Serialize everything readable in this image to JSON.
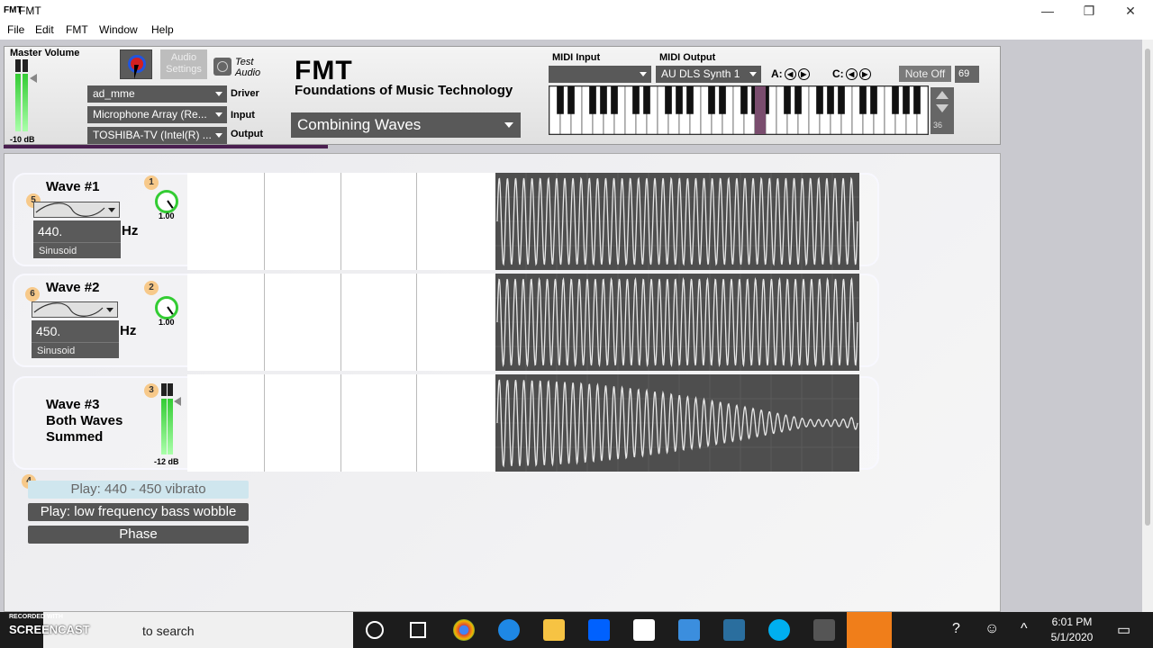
{
  "window": {
    "app_icon": "FMT",
    "title": "FMT",
    "controls": {
      "minimize": "—",
      "restore": "❐",
      "close": "✕"
    }
  },
  "menu": [
    "File",
    "Edit",
    "FMT",
    "Window",
    "Help"
  ],
  "header": {
    "master_volume_label": "Master Volume",
    "master_volume_db": "-10 dB",
    "audio_settings_label": "Audio Settings",
    "test_audio_label": "Test Audio",
    "driver_value": "ad_mme",
    "driver_label": "Driver",
    "input_value": "Microphone Array (Re...",
    "input_label": "Input",
    "output_value": "TOSHIBA-TV (Intel(R) ...",
    "output_label": "Output",
    "app_name": "FMT",
    "app_subtitle": "Foundations of Music Technology",
    "topic_value": "Combining Waves"
  },
  "midi": {
    "input_label": "MIDI Input",
    "input_value": "",
    "output_label": "MIDI Output",
    "output_value": "AU DLS Synth 1",
    "a_label": "A:",
    "c_label": "C:",
    "note_off_label": "Note Off",
    "note_value": "69",
    "octave_value": "36",
    "highlighted_key_color": "#7a4d6e"
  },
  "waves": [
    {
      "badge": "5",
      "title": "Wave #1",
      "frequency": "440.",
      "hz_label": "Hz",
      "shape": "Sinusoid",
      "knob_badge": "1",
      "gain": "1.00"
    },
    {
      "badge": "6",
      "title": "Wave #2",
      "frequency": "450.",
      "hz_label": "Hz",
      "shape": "Sinusoid",
      "knob_badge": "2",
      "gain": "1.00"
    }
  ],
  "wave3": {
    "title_line1": "Wave #3",
    "title_line2": "Both Waves",
    "title_line3": "Summed",
    "meter_badge": "3",
    "meter_db": "-12 dB"
  },
  "presets": {
    "badge": "4",
    "buttons": [
      "Play: 440 - 450 vibrato",
      "Play: low frequency bass wobble",
      "Phase"
    ],
    "selected_index": 0
  },
  "taskbar": {
    "recorded_with": "RECORDED WITH",
    "brand": "SCREENCAST",
    "search_text": "to search",
    "time": "6:01 PM",
    "date": "5/1/2020"
  },
  "colors": {
    "accent_green": "#33cc33",
    "scope_bg": "#4e4e4e",
    "badge_orange": "#f7c98a",
    "dark_control": "#595959"
  }
}
